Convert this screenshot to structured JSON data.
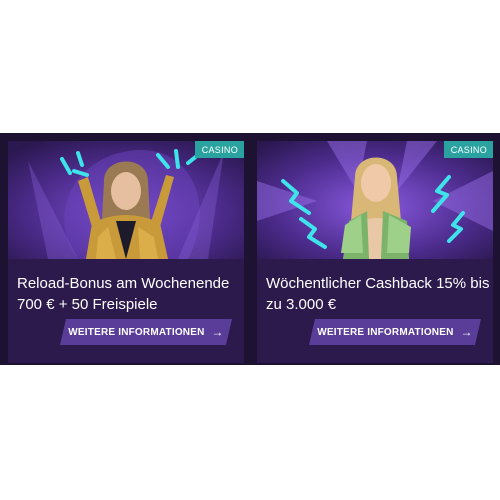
{
  "cards": [
    {
      "badge": "CASINO",
      "title_line1": "Reload-Bonus am Wochenende",
      "title_line2": "700 € + 50 Freispiele",
      "button_label": "WEITERE INFORMATIONEN",
      "button_icon": "arrow-right-icon",
      "image": "woman-gold-jacket-pointing-up"
    },
    {
      "badge": "CASINO",
      "title_line1": "Wöchentlicher Cashback 15% bis",
      "title_line2": "zu 3.000 €",
      "button_label": "WEITERE INFORMATIONEN",
      "button_icon": "arrow-right-icon",
      "image": "woman-holding-banknotes"
    }
  ],
  "colors": {
    "strip": "#1e1233",
    "card_bg": "#2c1a4d",
    "badge": "#2aa3a0",
    "button": "#5a3d98",
    "accent_cyan": "#3fe3ea"
  }
}
